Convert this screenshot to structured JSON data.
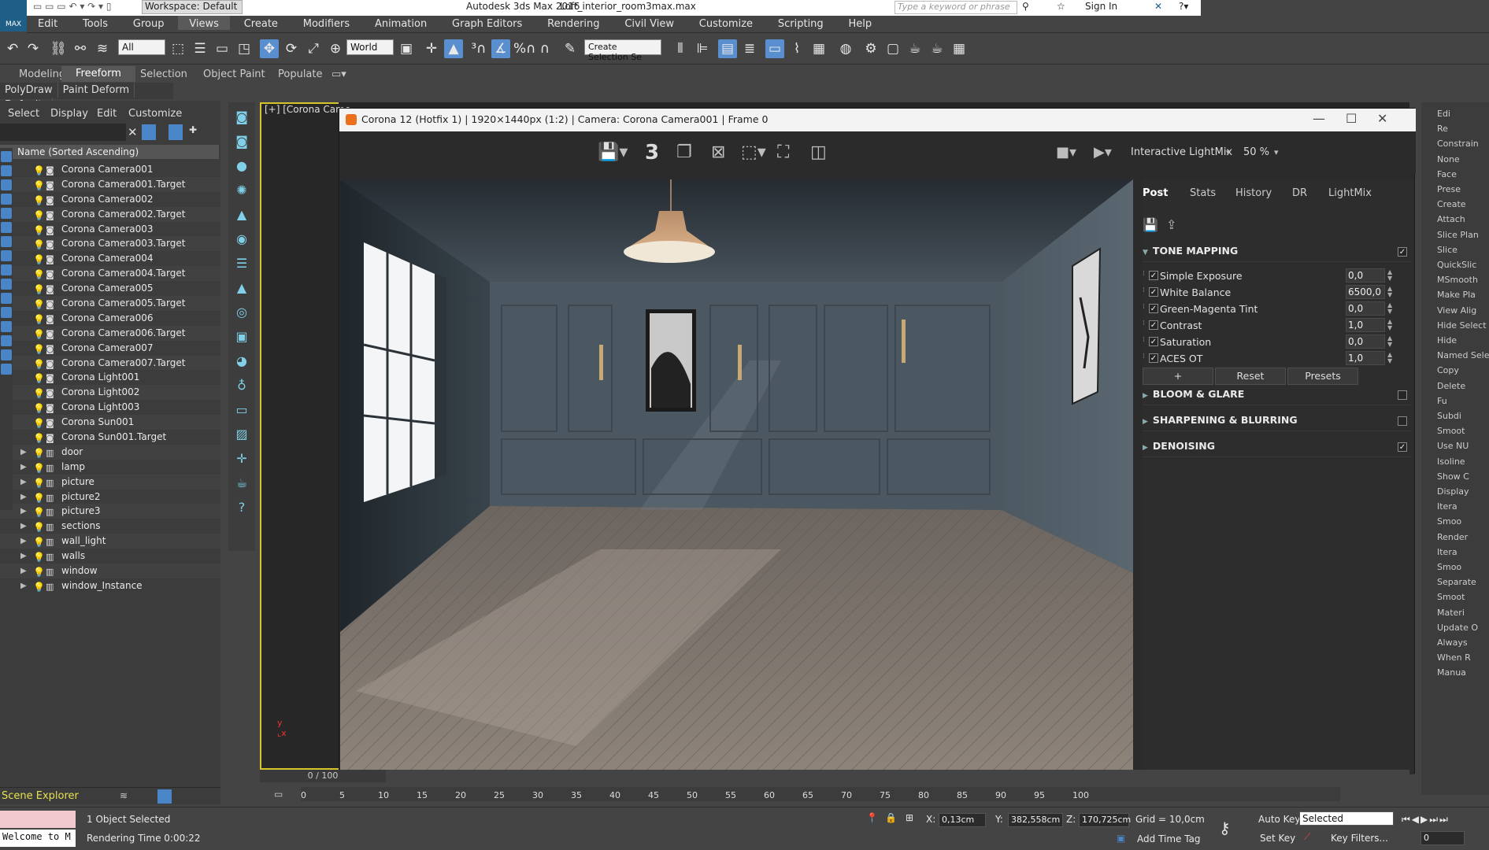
{
  "app": {
    "title": "Autodesk 3ds Max 2016",
    "file": "Loft_interior_room3max.max",
    "logo_text": "MAX"
  },
  "workspace": "Workspace: Default",
  "search_placeholder": "Type a keyword or phrase",
  "sign_in": "Sign In",
  "menu": [
    "Edit",
    "Tools",
    "Group",
    "Views",
    "Create",
    "Modifiers",
    "Animation",
    "Graph Editors",
    "Rendering",
    "Civil View",
    "Customize",
    "Scripting",
    "Help"
  ],
  "toolbar": {
    "filter": "All",
    "coord": "World",
    "named_sel": "Create Selection Se"
  },
  "ribbon_tabs": [
    "Modeling",
    "Freeform",
    "Selection",
    "Object Paint",
    "Populate"
  ],
  "subribbon": [
    "PolyDraw",
    "Paint Deform",
    "Defaults"
  ],
  "scene_explorer": {
    "menu": [
      "Select",
      "Display",
      "Edit",
      "Customize"
    ],
    "header": "Name (Sorted Ascending)",
    "items": [
      {
        "name": "Corona Camera001",
        "group": false
      },
      {
        "name": "Corona Camera001.Target",
        "group": false
      },
      {
        "name": "Corona Camera002",
        "group": false
      },
      {
        "name": "Corona Camera002.Target",
        "group": false
      },
      {
        "name": "Corona Camera003",
        "group": false
      },
      {
        "name": "Corona Camera003.Target",
        "group": false
      },
      {
        "name": "Corona Camera004",
        "group": false
      },
      {
        "name": "Corona Camera004.Target",
        "group": false
      },
      {
        "name": "Corona Camera005",
        "group": false
      },
      {
        "name": "Corona Camera005.Target",
        "group": false
      },
      {
        "name": "Corona Camera006",
        "group": false
      },
      {
        "name": "Corona Camera006.Target",
        "group": false
      },
      {
        "name": "Corona Camera007",
        "group": false
      },
      {
        "name": "Corona Camera007.Target",
        "group": false
      },
      {
        "name": "Corona Light001",
        "group": false
      },
      {
        "name": "Corona Light002",
        "group": false
      },
      {
        "name": "Corona Light003",
        "group": false
      },
      {
        "name": "Corona Sun001",
        "group": false
      },
      {
        "name": "Corona Sun001.Target",
        "group": false
      },
      {
        "name": "door",
        "group": true
      },
      {
        "name": "lamp",
        "group": true
      },
      {
        "name": "picture",
        "group": true
      },
      {
        "name": "picture2",
        "group": true
      },
      {
        "name": "picture3",
        "group": true
      },
      {
        "name": "sections",
        "group": true
      },
      {
        "name": "wall_light",
        "group": true
      },
      {
        "name": "walls",
        "group": true
      },
      {
        "name": "window",
        "group": true
      },
      {
        "name": "window_Instance",
        "group": true
      }
    ],
    "footer": "Scene Explorer"
  },
  "viewport": {
    "label": "[+] [Corona Came"
  },
  "vfb": {
    "title": "Corona 12 (Hotfix 1) | 1920×1440px (1:2) | Camera: Corona Camera001 | Frame 0",
    "pass_count": "3",
    "lightmix": "Interactive LightMix",
    "zoom": "50 %",
    "tabs": [
      "Post",
      "Stats",
      "History",
      "DR",
      "LightMix"
    ],
    "active_tab": "Post",
    "tone_mapping": {
      "title": "TONE MAPPING",
      "checked": true,
      "rows": [
        {
          "name": "Simple Exposure",
          "value": "0,0"
        },
        {
          "name": "White Balance",
          "value": "6500,0"
        },
        {
          "name": "Green-Magenta Tint",
          "value": "0,0"
        },
        {
          "name": "Contrast",
          "value": "1,0"
        },
        {
          "name": "Saturation",
          "value": "0,0"
        },
        {
          "name": "ACES OT",
          "value": "1,0"
        }
      ]
    },
    "buttons": {
      "add": "+",
      "reset": "Reset",
      "presets": "Presets"
    },
    "sections": [
      {
        "title": "BLOOM & GLARE",
        "checked": false
      },
      {
        "title": "SHARPENING & BLURRING",
        "checked": false
      },
      {
        "title": "DENOISING",
        "checked": true
      }
    ]
  },
  "right_panel": [
    "Edi",
    "Re",
    "Constrain",
    "None",
    "Face",
    "Prese",
    "Create",
    "Attach",
    "Slice Plan",
    "Slice",
    "QuickSlic",
    "MSmooth",
    "Make Pla",
    "View Alig",
    "Hide Select",
    "Hide",
    "Named Sele",
    "Copy",
    "Delete",
    "Fu",
    "Subdi",
    "Smoot",
    "Use NU",
    "Isoline",
    "Show C",
    "Display",
    "Itera",
    "Smoo",
    "Render",
    "Itera",
    "Smoo",
    "Separate",
    "Smoot",
    "Materi",
    "Update O",
    "Always",
    "When R",
    "Manua"
  ],
  "timeline": {
    "position": "0 / 100",
    "ticks": [
      "0",
      "5",
      "10",
      "15",
      "20",
      "25",
      "30",
      "35",
      "40",
      "45",
      "50",
      "55",
      "60",
      "65",
      "70",
      "75",
      "80",
      "85",
      "90",
      "95",
      "100"
    ]
  },
  "status": {
    "welcome": "Welcome to M",
    "selected": "1 Object Selected",
    "render_time": "Rendering Time  0:00:22",
    "x": "0,13cm",
    "y": "382,558cm",
    "z": "170,725cm",
    "grid": "Grid = 10,0cm",
    "add_time_tag": "Add Time Tag",
    "auto_key": "Auto Key",
    "set_key": "Set Key",
    "key_mode": "Selected",
    "key_filters": "Key Filters...",
    "frame": "0"
  }
}
